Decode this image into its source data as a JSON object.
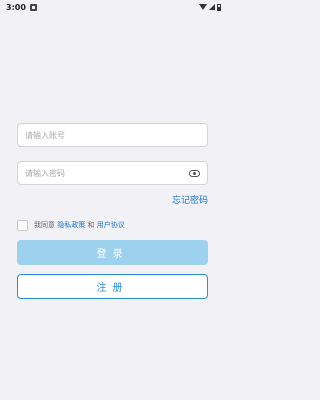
{
  "status_bar": {
    "time": "3:00",
    "icons": [
      "notification-icon",
      "wifi-icon",
      "signal-icon",
      "battery-icon"
    ]
  },
  "login_form": {
    "account_placeholder": "请输入账号",
    "password_placeholder": "请输入密码",
    "password_toggle_icon": "eye-icon",
    "forgot_password": "忘记密码",
    "agreement": {
      "prefix": "我同意",
      "privacy_policy": "隐私政策",
      "conjunction": "和",
      "user_agreement": "用户协议",
      "checked": false
    },
    "login_button": "登录",
    "register_button": "注册"
  },
  "colors": {
    "background": "#f1f1f6",
    "link": "#1a73c7",
    "login_button": "#9dd1ee",
    "register_border": "#2b8fd6"
  }
}
